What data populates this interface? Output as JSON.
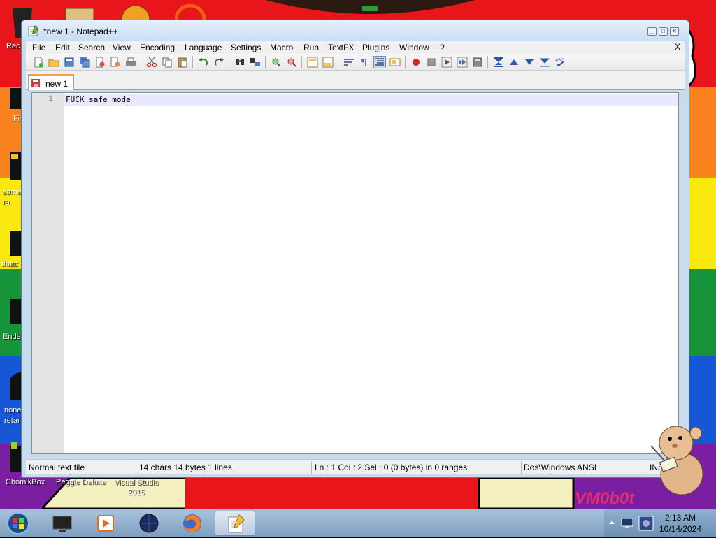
{
  "window": {
    "title": "*new 1 - Notepad++"
  },
  "menubar": {
    "items": [
      "File",
      "Edit",
      "Search",
      "View",
      "Encoding",
      "Language",
      "Settings",
      "Macro",
      "Run",
      "TextFX",
      "Plugins",
      "Window",
      "?"
    ],
    "close_label": "X"
  },
  "tabs": [
    {
      "label": "new 1",
      "active": true
    }
  ],
  "editor": {
    "line_numbers": [
      "1"
    ],
    "lines": [
      "FUCK safe mode"
    ]
  },
  "statusbar": {
    "file_type": "Normal text file",
    "counts": "14 chars   14 bytes   1 lines",
    "position": "Ln : 1    Col : 2    Sel : 0 (0 bytes) in 0 ranges",
    "eol_encoding": "Dos\\Windows  ANSI",
    "mode": "INS"
  },
  "desktop": {
    "icon_labels": [
      "Rec",
      "Fi",
      "some ra",
      "thatc",
      "Ende",
      "none retar",
      "ChomikBox",
      "Peggle Deluxe",
      "Visual Studio 2015"
    ],
    "watermark": "VM0b0t"
  },
  "taskbar": {
    "time": "2:13 AM",
    "date": "10/14/2024"
  },
  "colors": {
    "accent_tab": "#f0a040",
    "current_line": "#e8e8ff",
    "taskbar": "#8fb0cf"
  }
}
